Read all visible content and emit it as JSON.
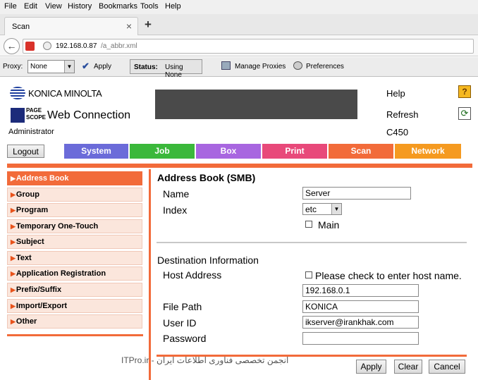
{
  "browser": {
    "menu": [
      "File",
      "Edit",
      "View",
      "History",
      "Bookmarks",
      "Tools",
      "Help"
    ],
    "tab_title": "Scan",
    "new_tab_symbol": "+",
    "url_host": "192.168.0.87",
    "url_path": "/a_abbr.xml",
    "toolbar": {
      "proxy_label": "Proxy:",
      "proxy_value": "None",
      "apply_label": "Apply",
      "status_label": "Status:",
      "status_value": "Using None",
      "manage_proxies": "Manage Proxies",
      "preferences": "Preferences"
    }
  },
  "header": {
    "brand": "KONICA MINOLTA",
    "pagescope_line1": "PAGE",
    "pagescope_line2": "SCOPE",
    "product": "Web Connection",
    "user_role": "Administrator",
    "logout_label": "Logout",
    "help_label": "Help",
    "refresh_label": "Refresh",
    "model": "C450"
  },
  "nav_tabs": [
    {
      "label": "System",
      "color": "#6b6bd9"
    },
    {
      "label": "Job",
      "color": "#3bb83b"
    },
    {
      "label": "Box",
      "color": "#a866e0"
    },
    {
      "label": "Print",
      "color": "#e8497a"
    },
    {
      "label": "Scan",
      "color": "#f26b3a"
    },
    {
      "label": "Network",
      "color": "#f59a20"
    }
  ],
  "sidebar": {
    "items": [
      {
        "label": "Address Book",
        "active": true
      },
      {
        "label": "Group"
      },
      {
        "label": "Program"
      },
      {
        "label": "Temporary One-Touch"
      },
      {
        "label": "Subject"
      },
      {
        "label": "Text"
      },
      {
        "label": "Application Registration"
      },
      {
        "label": "Prefix/Suffix"
      },
      {
        "label": "Import/Export"
      },
      {
        "label": "Other"
      }
    ]
  },
  "form": {
    "title": "Address Book (SMB)",
    "name_label": "Name",
    "name_value": "Server",
    "index_label": "Index",
    "index_value": "etc",
    "main_label": "Main",
    "dest_title": "Destination Information",
    "host_label": "Host Address",
    "host_check_label": "Please check to enter host name.",
    "host_value": "192.168.0.1",
    "path_label": "File Path",
    "path_value": "KONICA",
    "user_label": "User ID",
    "user_value": "ikserver@irankhak.com",
    "password_label": "Password",
    "password_value": "",
    "apply_label": "Apply",
    "clear_label": "Clear",
    "cancel_label": "Cancel"
  },
  "watermark": "انجمن تخصصی فناوری اطلاعات ایران - ITPro.ir",
  "colors": {
    "accent": "#f26b3a",
    "sidebar_active": "#f26b3a",
    "sidebar_bg": "#fbe6dc"
  }
}
